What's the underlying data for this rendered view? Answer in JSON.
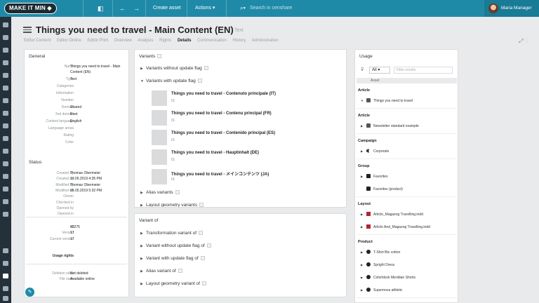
{
  "topbar": {
    "logo": "MAKE IT MIN",
    "create_asset": "Create asset",
    "actions": "Actions",
    "search_placeholder": "Search in censhare",
    "user_name": "Maria Manager"
  },
  "header": {
    "title": "Things you need to travel - Main Content (EN)",
    "type_label": "Text",
    "tabs": [
      "Editor Content",
      "Editor Online",
      "Editor Print",
      "Overview",
      "Analysis",
      "Rights",
      "Details",
      "Communication",
      "History",
      "Administration"
    ],
    "active_tab": "Details"
  },
  "general": {
    "title": "General",
    "fields": [
      {
        "k": "Name",
        "v": "Things you need to travel - Main Content (EN)"
      },
      {
        "k": "Type",
        "v": "Text"
      },
      {
        "k": "Categories",
        "v": ""
      },
      {
        "k": "Information",
        "v": ""
      },
      {
        "k": "Number",
        "v": ""
      },
      {
        "k": "Domain",
        "v": "Shared"
      },
      {
        "k": "2nd domain",
        "v": "Root"
      },
      {
        "k": "Content language",
        "v": "English"
      },
      {
        "k": "Language areas",
        "v": ""
      },
      {
        "k": "Rating",
        "v": ""
      },
      {
        "k": "Color",
        "v": ""
      }
    ]
  },
  "status": {
    "title": "Status",
    "fields": [
      {
        "k": "Created by",
        "v": "Thomas Obermeier"
      },
      {
        "k": "Created on",
        "v": "10.05.2019 4:35 PM"
      },
      {
        "k": "Modified by",
        "v": "Thomas Obermeier"
      },
      {
        "k": "Modified on",
        "v": "05.05.2019 5:32 PM"
      },
      {
        "k": "Owner",
        "v": ""
      },
      {
        "k": "Checked in",
        "v": ""
      },
      {
        "k": "Opened by",
        "v": ""
      },
      {
        "k": "Opened in",
        "v": ""
      }
    ]
  },
  "ids": {
    "fields": [
      {
        "k": "ID",
        "v": "40275"
      },
      {
        "k": "Version",
        "v": "17"
      },
      {
        "k": "Current version",
        "v": "17"
      }
    ],
    "usage_rights_label": "Usage rights"
  },
  "rights": {
    "fields": [
      {
        "k": "Deletion state",
        "v": "Not deleted"
      },
      {
        "k": "File state",
        "v": "Available online"
      }
    ]
  },
  "variants": {
    "title": "Variants",
    "without_update": "Variants without update flag",
    "with_update": "Variants with update flag",
    "items": [
      {
        "title": "Things you need to travel - Contenuto principale (IT)",
        "sub": "IS"
      },
      {
        "title": "Things you need to travel - Contenu principal (FR)",
        "sub": "IS"
      },
      {
        "title": "Things you need to travel - Contenido principal (ES)",
        "sub": "IS"
      },
      {
        "title": "Things you need to travel - Hauptinhalt (DE)",
        "sub": "IS"
      },
      {
        "title": "Things you need to travel - メインコンテンツ (JA)",
        "sub": "IS"
      }
    ],
    "alias": "Alias variants",
    "layout_geometry": "Layout geometry variants"
  },
  "variant_of": {
    "title": "Variant of",
    "rows": [
      "Transformation variant of",
      "Variant without update flag of",
      "Variant with update flag of",
      "Alias variant of",
      "Layout geometry variant of"
    ]
  },
  "usage": {
    "title": "Usage",
    "filter_selected": "All",
    "search_placeholder": "Filter results",
    "column_header": "Asset",
    "groups": [
      {
        "name": "Article",
        "items": [
          {
            "label": "Things you need to travel",
            "icon": "doc",
            "arrow": "▼"
          }
        ]
      },
      {
        "name": "Article",
        "items": [
          {
            "label": "Newsletter standard example",
            "icon": "doc",
            "arrow": "▶"
          }
        ]
      },
      {
        "name": "Campaign",
        "items": [
          {
            "label": "Corporate",
            "icon": "camp",
            "arrow": "▶"
          }
        ]
      },
      {
        "name": "Group",
        "items": [
          {
            "label": "Favorites",
            "icon": "folder",
            "arrow": "▶"
          },
          {
            "label": "Favorites (product)",
            "icon": "folder",
            "arrow": ""
          }
        ]
      },
      {
        "name": "Layout",
        "items": [
          {
            "label": "Article_Magazog Travelling.indd",
            "icon": "red",
            "arrow": "▶"
          },
          {
            "label": "Article And_Magazog Travelling.indd",
            "icon": "red",
            "arrow": "▶"
          }
        ]
      },
      {
        "name": "Product",
        "items": [
          {
            "label": "T-Shirt Bio cotton",
            "icon": "circ",
            "arrow": "▶"
          },
          {
            "label": "Spright Dress",
            "icon": "circ",
            "arrow": "▶"
          },
          {
            "label": "Colorblock Meridian Shorts",
            "icon": "circ",
            "arrow": "▶"
          },
          {
            "label": "Supernova athletic",
            "icon": "circ",
            "arrow": "▶"
          }
        ]
      }
    ]
  },
  "colors": {
    "topbar": "#1f8aa8",
    "sidebar": "#24313a",
    "layout_icon": "#b3262d"
  }
}
